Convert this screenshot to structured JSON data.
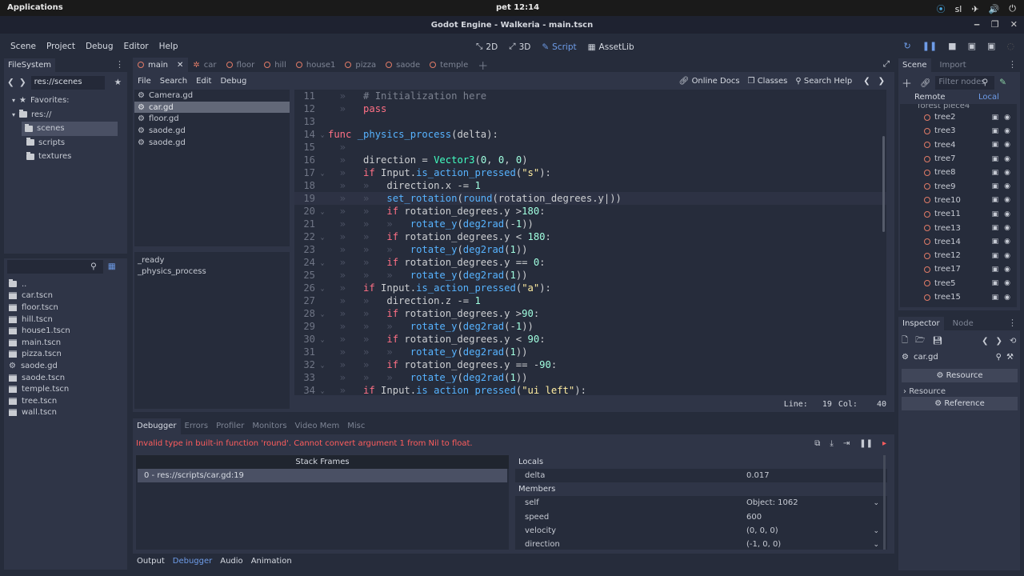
{
  "system": {
    "apps": "Applications",
    "clock": "pet 12:14",
    "tray": [
      "⦿",
      "sl",
      "✈",
      "🔊",
      "⏻"
    ]
  },
  "window": {
    "title": "Godot Engine - Walkeria - main.tscn"
  },
  "menu": {
    "items": [
      "Scene",
      "Project",
      "Debug",
      "Editor",
      "Help"
    ]
  },
  "modes": {
    "two_d": "2D",
    "three_d": "3D",
    "script": "Script",
    "assetlib": "AssetLib"
  },
  "filesystem": {
    "tab": "FileSystem",
    "path": "res://scenes",
    "favorites": "Favorites:",
    "root": "res://",
    "folders": [
      "scenes",
      "scripts",
      "textures"
    ],
    "files": [
      "..",
      "car.tscn",
      "floor.tscn",
      "hill.tscn",
      "house1.tscn",
      "main.tscn",
      "pizza.tscn",
      "saode.gd",
      "saode.tscn",
      "temple.tscn",
      "tree.tscn",
      "wall.tscn"
    ]
  },
  "scene_tabs": [
    "main",
    "car",
    "floor",
    "hill",
    "house1",
    "pizza",
    "saode",
    "temple"
  ],
  "editor": {
    "menu": [
      "File",
      "Search",
      "Edit",
      "Debug"
    ],
    "online_docs": "Online Docs",
    "classes": "Classes",
    "search_help": "Search Help",
    "scripts": [
      "Camera.gd",
      "car.gd",
      "floor.gd",
      "saode.gd",
      "saode.gd"
    ],
    "methods": [
      "_ready",
      "_physics_process"
    ],
    "status": {
      "line_label": "Line:",
      "line": "19",
      "col_label": "Col:",
      "col": "40"
    }
  },
  "debugger": {
    "tabs": [
      "Debugger",
      "Errors",
      "Profiler",
      "Monitors",
      "Video Mem",
      "Misc"
    ],
    "error": "Invalid type in built-in function 'round'. Cannot convert argument 1 from Nil to float.",
    "stack_header": "Stack Frames",
    "stack_row": "0 - res://scripts/car.gd:19",
    "locals_label": "Locals",
    "members_label": "Members",
    "locals": [
      {
        "k": "delta",
        "v": "0.017"
      }
    ],
    "members": [
      {
        "k": "self",
        "v": "Object: 1062"
      },
      {
        "k": "speed",
        "v": "600"
      },
      {
        "k": "velocity",
        "v": "(0, 0, 0)"
      },
      {
        "k": "direction",
        "v": "(-1, 0, 0)"
      }
    ]
  },
  "bottom_tabs": [
    "Output",
    "Debugger",
    "Audio",
    "Animation"
  ],
  "scene": {
    "tab": "Scene",
    "import_tab": "Import",
    "filter_placeholder": "Filter nodes",
    "remote": "Remote",
    "local": "Local",
    "partial_node": "forest piece4",
    "nodes": [
      "tree2",
      "tree3",
      "tree4",
      "tree7",
      "tree8",
      "tree9",
      "tree10",
      "tree11",
      "tree13",
      "tree14",
      "tree12",
      "tree17",
      "tree5",
      "tree15"
    ]
  },
  "inspector": {
    "tab": "Inspector",
    "node_tab": "Node",
    "resource_name": "car.gd",
    "resource_btn": "Resource",
    "resource_label": "Resource",
    "reference_btn": "Reference"
  }
}
